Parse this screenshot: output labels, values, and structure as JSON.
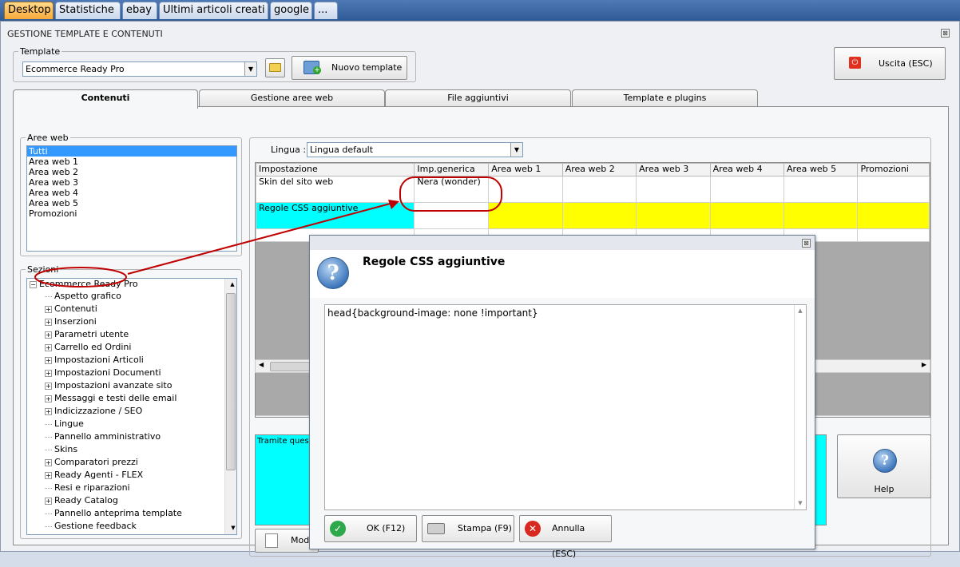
{
  "top_tabs": [
    "Desktop",
    "Statistiche",
    "ebay",
    "Ultimi articoli creati",
    "google",
    "..."
  ],
  "window": {
    "title": "GESTIONE TEMPLATE E CONTENUTI",
    "close": "⊠"
  },
  "template_group": {
    "legend": "Template",
    "selected": "Ecommerce Ready Pro",
    "new_button": "Nuovo template"
  },
  "exit_button": "Uscita (ESC)",
  "sub_tabs": [
    "Contenuti",
    "Gestione aree web",
    "File aggiuntivi",
    "Template e plugins"
  ],
  "aree_web": {
    "legend": "Aree web",
    "items": [
      "Tutti",
      "Area web 1",
      "Area web 2",
      "Area web 3",
      "Area web 4",
      "Area web 5",
      "Promozioni"
    ]
  },
  "sezioni": {
    "legend": "Sezioni",
    "root": "Ecommerce Ready Pro",
    "items": [
      {
        "label": "Aspetto grafico",
        "expandable": false
      },
      {
        "label": "Contenuti",
        "expandable": true
      },
      {
        "label": "Inserzioni",
        "expandable": true
      },
      {
        "label": "Parametri utente",
        "expandable": true
      },
      {
        "label": "Carrello ed Ordini",
        "expandable": true
      },
      {
        "label": "Impostazioni Articoli",
        "expandable": true
      },
      {
        "label": "Impostazioni Documenti",
        "expandable": true
      },
      {
        "label": "Impostazioni avanzate sito",
        "expandable": true
      },
      {
        "label": "Messaggi e testi delle email",
        "expandable": true
      },
      {
        "label": "Indicizzazione / SEO",
        "expandable": true
      },
      {
        "label": "Lingue",
        "expandable": false
      },
      {
        "label": "Pannello amministrativo",
        "expandable": false
      },
      {
        "label": "Skins",
        "expandable": false
      },
      {
        "label": "Comparatori prezzi",
        "expandable": true
      },
      {
        "label": "Ready Agenti - FLEX",
        "expandable": true
      },
      {
        "label": "Resi e riparazioni",
        "expandable": false
      },
      {
        "label": "Ready Catalog",
        "expandable": true
      },
      {
        "label": "Pannello anteprima template",
        "expandable": false
      },
      {
        "label": "Gestione feedback",
        "expandable": false
      }
    ]
  },
  "lingua": {
    "label": "Lingua :",
    "selected": "Lingua default"
  },
  "grid": {
    "headers": [
      "Impostazione",
      "Imp.generica",
      "Area web 1",
      "Area web 2",
      "Area web 3",
      "Area web 4",
      "Area web 5",
      "Promozioni"
    ],
    "rows": [
      [
        "Skin del sito web",
        "Nera (wonder)",
        "",
        "",
        "",
        "",
        "",
        ""
      ],
      [
        "Regole CSS aggiuntive",
        "",
        "",
        "",
        "",
        "",
        "",
        ""
      ]
    ]
  },
  "description_text": "Tramite questa",
  "modify_button": "Modi",
  "help_button": "Help",
  "dialog": {
    "title": "Regole CSS aggiuntive",
    "content": "head{background-image: none !important}",
    "ok": "OK (F12)",
    "print": "Stampa (F9)",
    "cancel": "Annulla (ESC)"
  },
  "colors": {
    "highlight_cyan": "#00ffff",
    "highlight_yellow": "#ffff00",
    "annotation_red": "#c00000"
  }
}
